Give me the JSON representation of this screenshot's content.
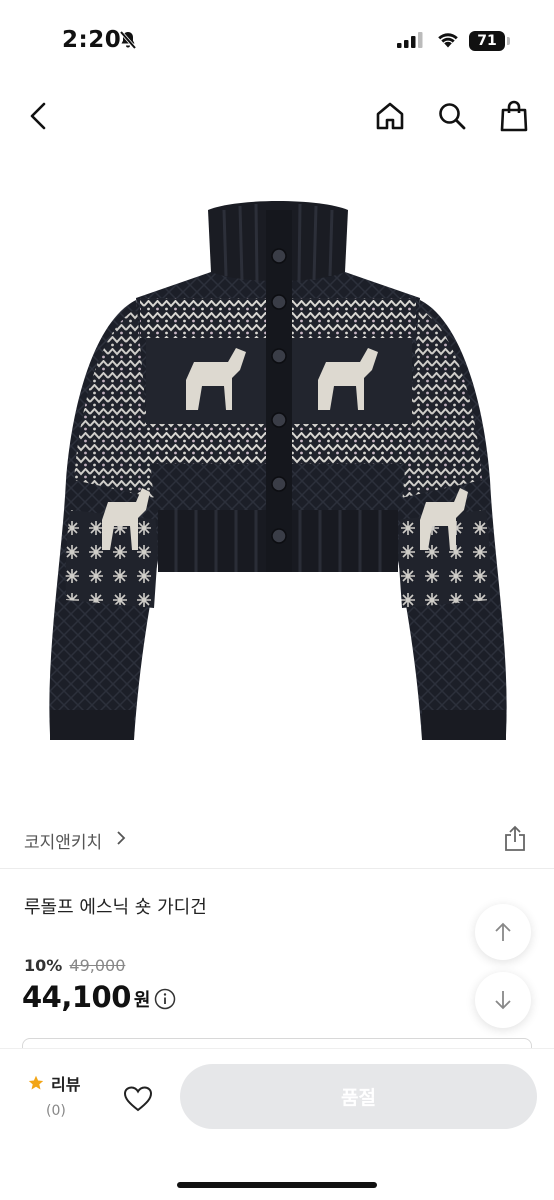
{
  "status_bar": {
    "time": "2:20",
    "battery": "71"
  },
  "header": {
    "back_icon": "chevron-left-icon",
    "home_icon": "home-icon",
    "search_icon": "search-icon",
    "bag_icon": "shopping-bag-icon"
  },
  "product": {
    "brand": "코지앤키치",
    "title": "루돌프 에스닉 숏 가디건",
    "discount_rate": "10%",
    "original_price": "49,000",
    "price": "44,100",
    "currency": "원",
    "image": "cardigan-photo"
  },
  "bottom_bar": {
    "review_label": "리뷰",
    "review_count": "(0)",
    "soldout_label": "품절"
  },
  "colors": {
    "accent_star": "#f2a516",
    "disabled_button": "#e6e7e9"
  }
}
